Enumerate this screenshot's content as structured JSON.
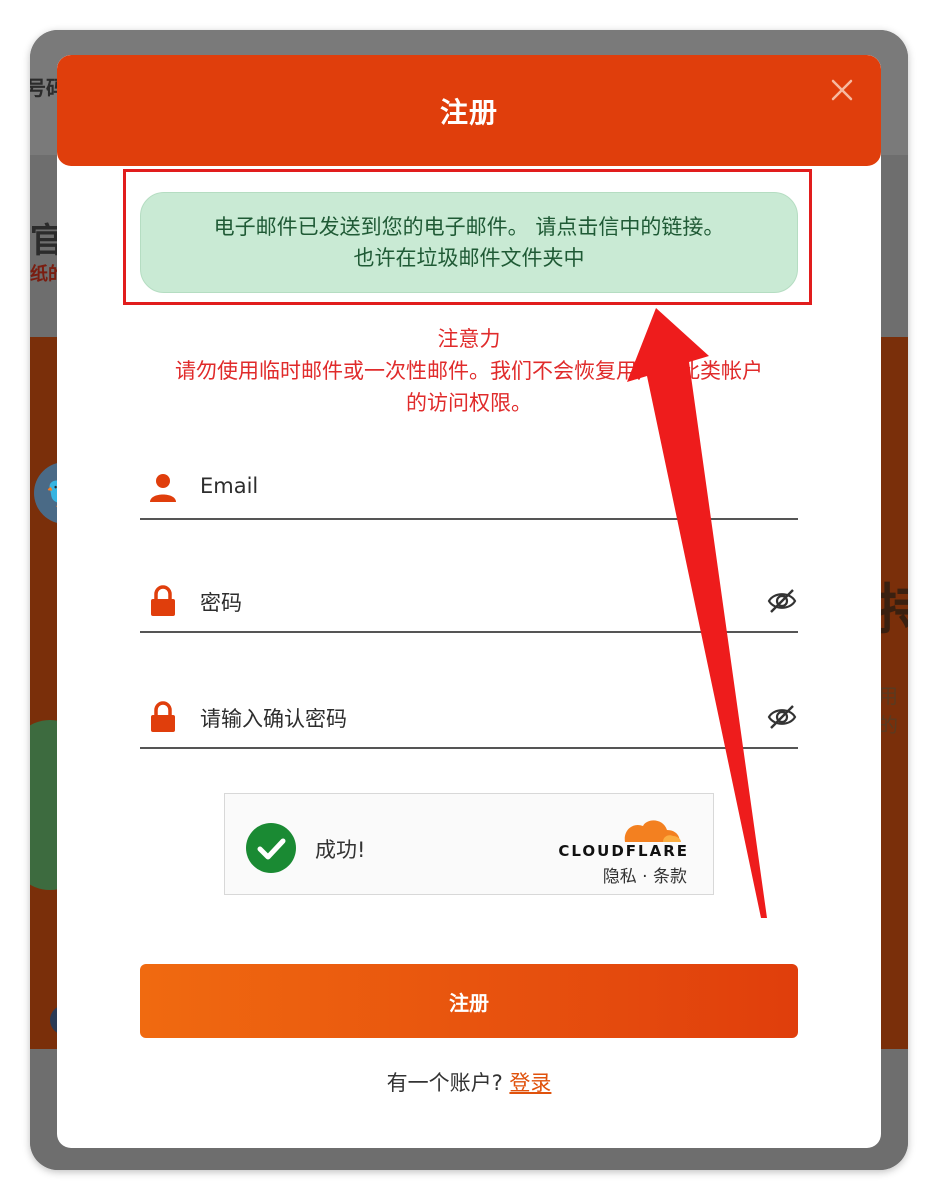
{
  "background": {
    "left_top_fragment": "号码",
    "left_mid_fragment": "官",
    "left_small_fragment": "纸的",
    "right_big_fragment": "持",
    "right_small_fragment": "用的",
    "twitter_glyph": "🐦"
  },
  "modal": {
    "title": "注册",
    "close_icon": "close-icon"
  },
  "success_message": {
    "line1": "电子邮件已发送到您的电子邮件。 请点击信中的链接。",
    "line2": "也许在垃圾邮件文件夹中"
  },
  "notice": {
    "heading": "注意力",
    "line1": "请勿使用临时邮件或一次性邮件。我们不会恢复用户对此类帐户",
    "line2": "的访问权限。"
  },
  "form": {
    "email_placeholder": "Email",
    "password_placeholder": "密码",
    "confirm_placeholder": "请输入确认密码"
  },
  "captcha": {
    "status": "成功!",
    "brand": "CLOUDFLARE",
    "links": "隐私 · 条款"
  },
  "submit_label": "注册",
  "login": {
    "prompt": "有一个账户?",
    "link": "登录"
  },
  "colors": {
    "accent": "#e03e0c",
    "success_bg": "#c9ead4",
    "notice": "#e02b2b",
    "highlight": "#e11d1d"
  }
}
